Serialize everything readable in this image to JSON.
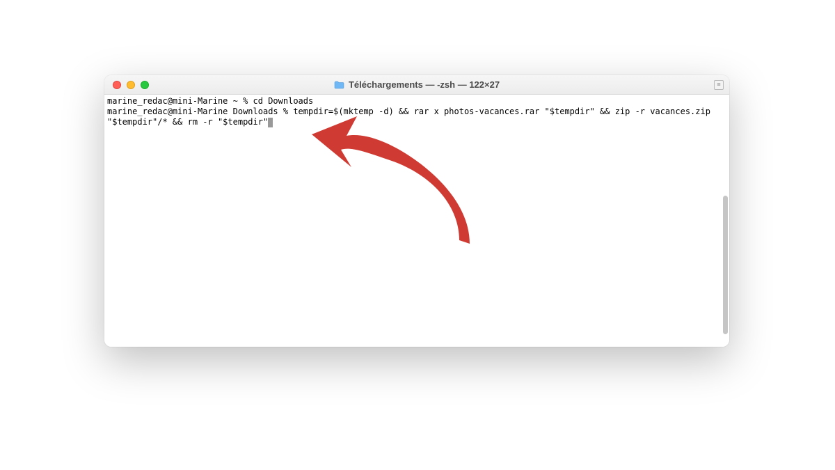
{
  "window": {
    "title": "Téléchargements — -zsh — 122×27",
    "icon": "folder-icon"
  },
  "traffic_lights": {
    "close": "close",
    "minimize": "minimize",
    "maximize": "maximize"
  },
  "terminal": {
    "line1_prompt": "marine_redac@mini-Marine ~ % ",
    "line1_cmd": "cd Downloads",
    "line2_prompt": "marine_redac@mini-Marine Downloads % ",
    "line2_cmd": "tempdir=$(mktemp -d) && rar x photos-vacances.rar \"$tempdir\" && zip -r vacances.zip \"$tempdir\"/* && rm -r \"$tempdir\""
  },
  "annotation": {
    "arrow_color": "#cf3b33"
  }
}
